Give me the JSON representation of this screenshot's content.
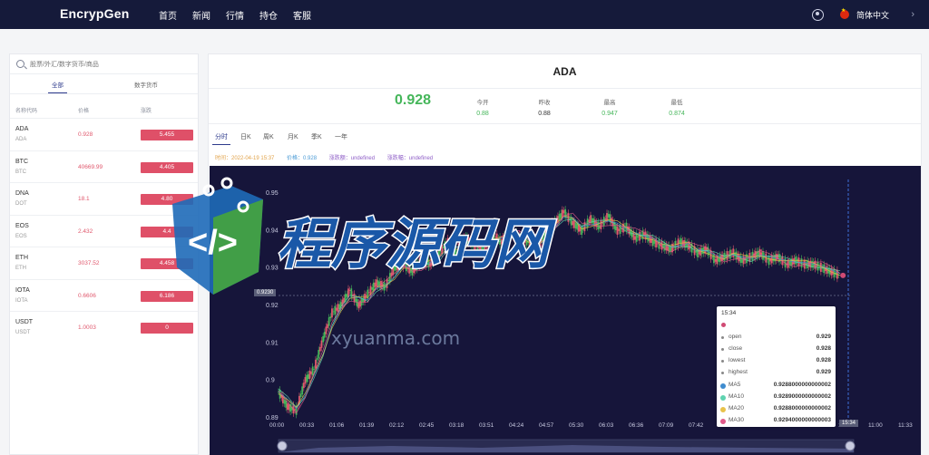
{
  "header": {
    "logo": "EncrypGen",
    "nav": [
      "首页",
      "新闻",
      "行情",
      "持仓",
      "客服"
    ],
    "language": "简体中文"
  },
  "left": {
    "search_placeholder": "股票/外汇/数字货币/商品",
    "tabs": [
      "全部",
      "数字货币"
    ],
    "columns": [
      "名称代码",
      "价格",
      "涨跌"
    ],
    "rows": [
      {
        "symbol": "ADA",
        "sub": "ADA",
        "price": "0.928",
        "change": "5.455"
      },
      {
        "symbol": "BTC",
        "sub": "BTC",
        "price": "40669.99",
        "change": "4.405"
      },
      {
        "symbol": "DNA",
        "sub": "DOT",
        "price": "18.1",
        "change": "4.80"
      },
      {
        "symbol": "EOS",
        "sub": "EOS",
        "price": "2.432",
        "change": "4.4"
      },
      {
        "symbol": "ETH",
        "sub": "ETH",
        "price": "3037.52",
        "change": "4.458"
      },
      {
        "symbol": "IOTA",
        "sub": "IOTA",
        "price": "0.6606",
        "change": "6.186"
      },
      {
        "symbol": "USDT",
        "sub": "USDT",
        "price": "1.0003",
        "change": "0"
      }
    ]
  },
  "main": {
    "title": "ADA",
    "price": "0.928",
    "stats": [
      {
        "label": "今开",
        "value": "0.88",
        "color": "#45b65a"
      },
      {
        "label": "昨收",
        "value": "0.88",
        "color": "#333333"
      },
      {
        "label": "最高",
        "value": "0.947",
        "color": "#45b65a"
      },
      {
        "label": "最低",
        "value": "0.874",
        "color": "#45b65a"
      }
    ],
    "ktabs": [
      "分时",
      "日K",
      "周K",
      "月K",
      "季K",
      "一年"
    ],
    "info": {
      "time": "时间：2022-04-19 15:37",
      "price": "价格：0.928",
      "change": "涨跌额：undefined",
      "pct": "涨跌幅：undefined"
    },
    "crosshair_price": "0.9230",
    "crosshair_time": "15:34"
  },
  "tooltip": {
    "time": "15:34",
    "rows": [
      {
        "k": "open",
        "v": "0.929"
      },
      {
        "k": "close",
        "v": "0.928"
      },
      {
        "k": "lowest",
        "v": "0.928"
      },
      {
        "k": "highest",
        "v": "0.929"
      }
    ],
    "ma": [
      {
        "k": "MA5",
        "v": "0.9288000000000002",
        "color": "#3f8ccf"
      },
      {
        "k": "MA10",
        "v": "0.9289000000000002",
        "color": "#5fd3b0"
      },
      {
        "k": "MA20",
        "v": "0.9288000000000002",
        "color": "#e8c24a"
      },
      {
        "k": "MA30",
        "v": "0.9294000000000003",
        "color": "#e15a8a"
      }
    ]
  },
  "chart_data": {
    "type": "line",
    "title": "",
    "xlabel": "",
    "ylabel": "",
    "yticks": [
      "0.95",
      "0.94",
      "0.93",
      "0.92",
      "0.91",
      "0.9",
      "0.89"
    ],
    "ylim": [
      0.89,
      0.95
    ],
    "xticks": [
      "00:00",
      "00:33",
      "01:06",
      "01:39",
      "02:12",
      "02:45",
      "03:18",
      "03:51",
      "04:24",
      "04:57",
      "05:30",
      "06:03",
      "06:36",
      "07:09",
      "07:42",
      "08:15",
      "08:48",
      "09:21",
      "09:54",
      "10:27",
      "11:00",
      "11:33"
    ],
    "x": [
      0,
      0.5,
      1,
      1.5,
      2,
      2.5,
      3,
      3.5,
      4,
      4.5,
      5,
      5.5,
      6,
      6.5,
      7,
      7.5,
      8,
      8.5,
      9,
      9.5,
      10,
      10.5,
      11,
      11.5,
      12,
      12.5,
      13,
      13.5,
      14,
      14.5,
      15,
      15.5,
      16,
      16.5,
      17,
      17.5,
      18,
      18.5,
      19,
      19.5,
      20,
      20.5,
      21,
      21.5,
      22,
      22.5,
      23,
      23.5,
      24,
      24.5,
      25,
      25.5,
      26,
      26.5,
      27,
      27.5,
      28,
      28.5,
      29,
      29.5,
      30,
      30.5,
      31,
      31.5
    ],
    "series": [
      {
        "values": [
          0.897,
          0.893,
          0.892,
          0.9,
          0.903,
          0.911,
          0.918,
          0.92,
          0.924,
          0.92,
          0.923,
          0.926,
          0.925,
          0.93,
          0.931,
          0.929,
          0.932,
          0.931,
          0.934,
          0.937,
          0.934,
          0.938,
          0.936,
          0.935,
          0.939,
          0.937,
          0.94,
          0.938,
          0.937,
          0.935,
          0.94,
          0.942,
          0.945,
          0.942,
          0.94,
          0.943,
          0.941,
          0.944,
          0.94,
          0.941,
          0.938,
          0.939,
          0.937,
          0.936,
          0.935,
          0.937,
          0.936,
          0.934,
          0.935,
          0.932,
          0.933,
          0.934,
          0.932,
          0.933,
          0.934,
          0.932,
          0.933,
          0.931,
          0.932,
          0.931,
          0.931,
          0.93,
          0.929,
          0.928
        ]
      }
    ]
  }
}
